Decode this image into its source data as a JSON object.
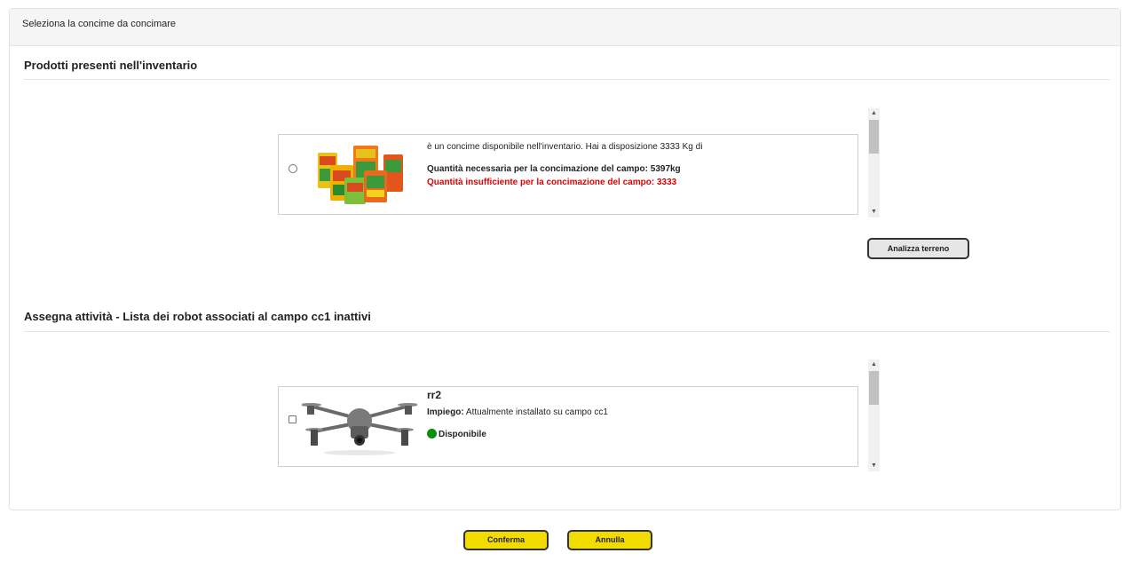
{
  "panel": {
    "header": "Seleziona la concime da concimare"
  },
  "inventory": {
    "title": "Prodotti presenti nell'inventario",
    "product": {
      "description": "è un concime disponibile nell'inventario. Hai a disposizione 3333 Kg di",
      "required": "Quantità necessaria per la concimazione del campo: 5397kg",
      "insufficient": "Quantità insufficiente per la concimazione del campo: 3333",
      "image": "fertilizer-bags-image"
    },
    "analyze_label": "Analizza terreno"
  },
  "robots": {
    "title": "Assegna attività - Lista dei robot associati al campo cc1 inattivi",
    "robot": {
      "name": "rr2",
      "usage_label": "Impiego:",
      "usage_value": " Attualmente installato su campo cc1",
      "status": "Disponibile",
      "status_color": "#0a8f0a",
      "image": "drone-image"
    }
  },
  "actions": {
    "confirm_label": "Conferma",
    "cancel_label": "Annulla"
  },
  "colors": {
    "button_yellow": "#f2dc00",
    "warning_red": "#e00000"
  }
}
